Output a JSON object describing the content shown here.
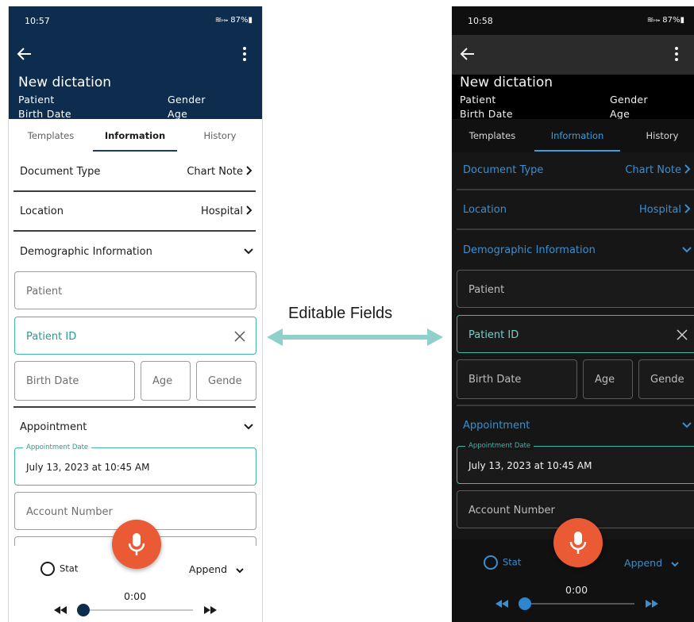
{
  "annotation": {
    "label": "Editable Fields"
  },
  "screens": {
    "light": {
      "status": {
        "time": "10:57",
        "system": "≋⤠ 87%▮"
      },
      "header": {
        "title": "New dictation",
        "patient": "Patient",
        "gender": "Gender",
        "birth_date": "Birth Date",
        "age": "Age"
      },
      "tabs": [
        "Templates",
        "Information",
        "History"
      ],
      "rows": {
        "document_type": {
          "label": "Document Type",
          "value": "Chart Note"
        },
        "location": {
          "label": "Location",
          "value": "Hospital"
        },
        "demographic": {
          "label": "Demographic Information"
        },
        "appointment": {
          "label": "Appointment"
        }
      },
      "fields": {
        "patient": "Patient",
        "patient_id": "Patient ID",
        "birth_date": "Birth Date",
        "age": "Age",
        "gender": "Gende",
        "appointment_label": "Appointment Date",
        "appointment_value": "July 13, 2023 at 10:45 AM",
        "account_number": "Account Number"
      },
      "player": {
        "stat": "Stat",
        "append": "Append",
        "time": "0:00",
        "progress": 0.0
      }
    },
    "dark": {
      "status": {
        "time": "10:58",
        "system": "≋⤠ 87%▮"
      },
      "header": {
        "title": "New dictation",
        "patient": "Patient",
        "gender": "Gender",
        "birth_date": "Birth Date",
        "age": "Age"
      },
      "tabs": [
        "Templates",
        "Information",
        "History"
      ],
      "rows": {
        "document_type": {
          "label": "Document Type",
          "value": "Chart Note"
        },
        "location": {
          "label": "Location",
          "value": "Hospital"
        },
        "demographic": {
          "label": "Demographic Information"
        },
        "appointment": {
          "label": "Appointment"
        }
      },
      "fields": {
        "patient": "Patient",
        "patient_id": "Patient ID",
        "birth_date": "Birth Date",
        "age": "Age",
        "gender": "Gende",
        "appointment_label": "Appointment Date",
        "appointment_value": "July 13, 2023 at 10:45 AM",
        "account_number": "Account Number"
      },
      "player": {
        "stat": "Stat",
        "append": "Append",
        "time": "0:00",
        "progress": 0.0
      }
    }
  },
  "colors": {
    "header_light": "#0e2c4d",
    "accent_teal": "#3fb7a9",
    "mic": "#ea5a34",
    "dark_accent": "#3a8fd0"
  }
}
